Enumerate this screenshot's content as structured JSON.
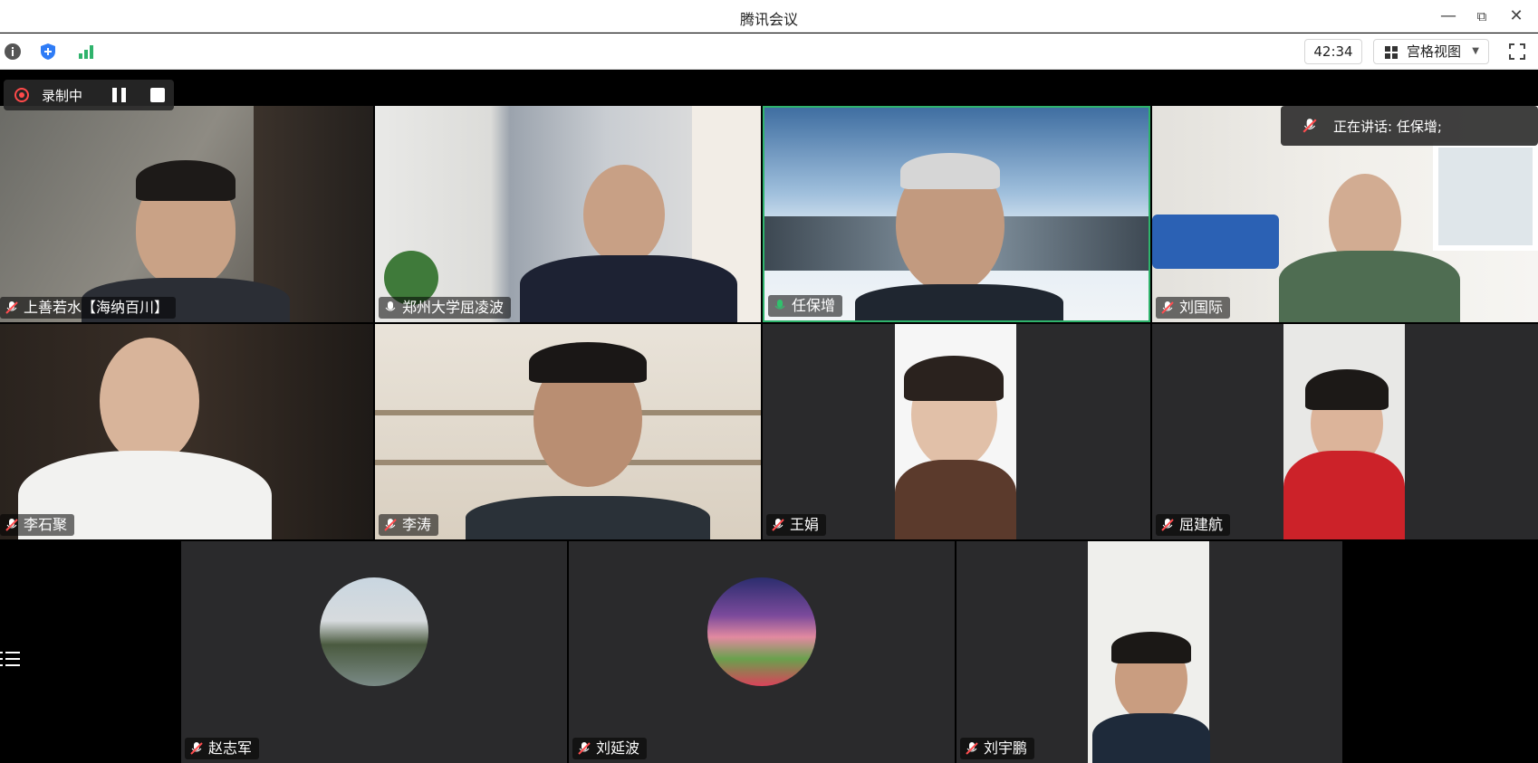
{
  "window": {
    "title": "腾讯会议"
  },
  "toolbar": {
    "timer": "42:34",
    "view_label": "宫格视图"
  },
  "recording": {
    "label": "录制中"
  },
  "speaking": {
    "label": "正在讲话: 任保增;"
  },
  "participants": [
    {
      "name": "上善若水【海纳百川】",
      "mic": "muted"
    },
    {
      "name": "郑州大学屈凌波",
      "mic": "on"
    },
    {
      "name": "任保增",
      "mic": "active"
    },
    {
      "name": "刘国际",
      "mic": "muted"
    },
    {
      "name": "李石聚",
      "mic": "muted"
    },
    {
      "name": "李涛",
      "mic": "muted"
    },
    {
      "name": "王娟",
      "mic": "muted"
    },
    {
      "name": "屈建航",
      "mic": "muted"
    },
    {
      "name": "赵志军",
      "mic": "muted"
    },
    {
      "name": "刘延波",
      "mic": "muted"
    },
    {
      "name": "刘宇鹏",
      "mic": "muted"
    }
  ],
  "colors": {
    "active_border": "#2fb36c",
    "mic_muted": "#ff4d4f",
    "mic_active": "#30c16d"
  }
}
